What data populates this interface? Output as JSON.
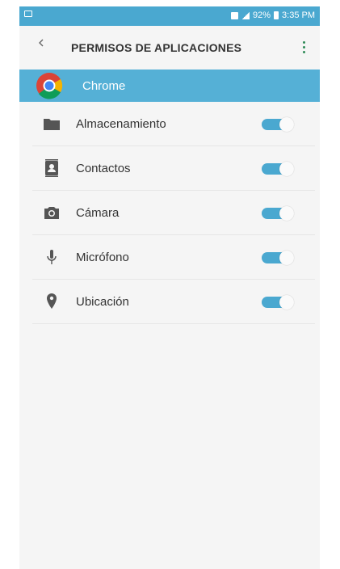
{
  "status_bar": {
    "battery": "92%",
    "time": "3:35 PM"
  },
  "header": {
    "title": "PERMISOS DE APLICACIONES",
    "back_icon": "chevron-left-icon",
    "menu_icon": "more-vert-icon"
  },
  "app": {
    "name": "Chrome",
    "icon": "chrome-logo"
  },
  "permissions": [
    {
      "label": "Almacenamiento",
      "icon": "folder-icon",
      "enabled": true
    },
    {
      "label": "Contactos",
      "icon": "contacts-icon",
      "enabled": true
    },
    {
      "label": "Cámara",
      "icon": "camera-icon",
      "enabled": true
    },
    {
      "label": "Micrófono",
      "icon": "microphone-icon",
      "enabled": true
    },
    {
      "label": "Ubicación",
      "icon": "location-icon",
      "enabled": true
    }
  ],
  "colors": {
    "accent": "#4aa8d0",
    "menu_dots": "#2e8b57"
  }
}
